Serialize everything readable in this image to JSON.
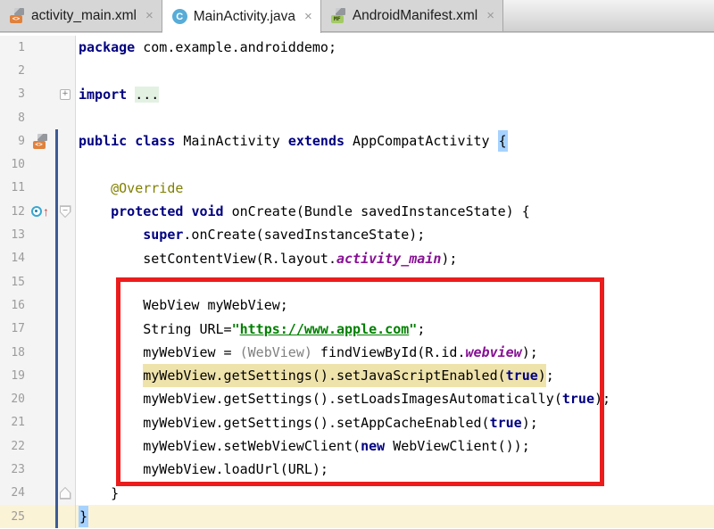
{
  "tabs": [
    {
      "id": "activity-main-xml",
      "label": "activity_main.xml",
      "icon": "layout-xml-icon",
      "glyph": "<>",
      "active": false
    },
    {
      "id": "mainactivity-java",
      "label": "MainActivity.java",
      "icon": "java-class-icon",
      "glyph": "C",
      "active": true
    },
    {
      "id": "androidmanifest-xml",
      "label": "AndroidManifest.xml",
      "icon": "manifest-xml-icon",
      "glyph": "MF",
      "active": false
    }
  ],
  "icons": {
    "close": "×",
    "fold_plus": "+",
    "fold_minus": "−",
    "override_arrow": "↑",
    "layout_badge": "<>",
    "manifest_badge": "MF",
    "java_class_letter": "C"
  },
  "colors": {
    "annotation_red": "#EC1C1C",
    "caret_row_highlight": "#FBF3D6",
    "statement_highlight": "#EFE3AC",
    "brace_match": "#A6D2FF",
    "keyword": "#000080",
    "string": "#008000",
    "resource_ref": "#871094",
    "annotation_text": "#808000",
    "vcs_modified_bar": "#3D5A96",
    "folded_code_bg": "#E3F1E3"
  },
  "annotation": {
    "shape": "rectangle",
    "color": "#EC1C1C"
  },
  "editor": {
    "lines": [
      {
        "num": "1",
        "indent": 0,
        "segments": [
          {
            "text": "package",
            "style": "kw"
          },
          {
            "text": " com.example.androiddemo;",
            "style": "plain"
          }
        ]
      },
      {
        "num": "2",
        "indent": 0,
        "segments": []
      },
      {
        "num": "3",
        "indent": 0,
        "fold": "plus",
        "segments": [
          {
            "text": "import",
            "style": "kw"
          },
          {
            "text": " ",
            "style": "plain"
          },
          {
            "text": "...",
            "style": "fold"
          }
        ]
      },
      {
        "num": "8",
        "indent": 0,
        "segments": []
      },
      {
        "num": "9",
        "indent": 0,
        "gutter_icon": "layout",
        "segments": [
          {
            "text": "public",
            "style": "kw"
          },
          {
            "text": " ",
            "style": "plain"
          },
          {
            "text": "class",
            "style": "kw"
          },
          {
            "text": " MainActivity ",
            "style": "plain"
          },
          {
            "text": "extends",
            "style": "kw"
          },
          {
            "text": " AppCompatActivity ",
            "style": "plain"
          },
          {
            "text": "{",
            "style": "brace"
          }
        ]
      },
      {
        "num": "10",
        "indent": 0,
        "segments": []
      },
      {
        "num": "11",
        "indent": 4,
        "segments": [
          {
            "text": "@Override",
            "style": "ann"
          }
        ]
      },
      {
        "num": "12",
        "indent": 4,
        "gutter_icon": "override",
        "fold": "open",
        "segments": [
          {
            "text": "protected",
            "style": "kw"
          },
          {
            "text": " ",
            "style": "plain"
          },
          {
            "text": "void",
            "style": "kw"
          },
          {
            "text": " onCreate(Bundle savedInstanceState) {",
            "style": "plain"
          }
        ]
      },
      {
        "num": "13",
        "indent": 8,
        "segments": [
          {
            "text": "super",
            "style": "kw"
          },
          {
            "text": ".onCreate(savedInstanceState);",
            "style": "plain"
          }
        ]
      },
      {
        "num": "14",
        "indent": 8,
        "segments": [
          {
            "text": "setContentView(R.layout.",
            "style": "plain"
          },
          {
            "text": "activity_main",
            "style": "res"
          },
          {
            "text": ");",
            "style": "plain"
          }
        ]
      },
      {
        "num": "15",
        "indent": 0,
        "segments": []
      },
      {
        "num": "16",
        "indent": 8,
        "segments": [
          {
            "text": "WebView myWebView;",
            "style": "plain"
          }
        ]
      },
      {
        "num": "17",
        "indent": 8,
        "segments": [
          {
            "text": "String URL=",
            "style": "plain"
          },
          {
            "text": "\"",
            "style": "str"
          },
          {
            "text": "https://www.apple.com",
            "style": "link"
          },
          {
            "text": "\"",
            "style": "str"
          },
          {
            "text": ";",
            "style": "plain"
          }
        ]
      },
      {
        "num": "18",
        "indent": 8,
        "segments": [
          {
            "text": "myWebView = ",
            "style": "plain"
          },
          {
            "text": "(WebView)",
            "style": "cast"
          },
          {
            "text": " findViewById(R.id.",
            "style": "plain"
          },
          {
            "text": "webview",
            "style": "res"
          },
          {
            "text": ");",
            "style": "plain"
          }
        ]
      },
      {
        "num": "19",
        "indent": 8,
        "segments": [
          {
            "text": "myWebView.getSettings().setJavaScriptEnabled(",
            "style": "plain hl"
          },
          {
            "text": "true",
            "style": "kw hl"
          },
          {
            "text": ")",
            "style": "plain hl"
          },
          {
            "text": ";",
            "style": "plain"
          }
        ]
      },
      {
        "num": "20",
        "indent": 8,
        "segments": [
          {
            "text": "myWebView.getSettings().setLoadsImagesAutomatically(",
            "style": "plain"
          },
          {
            "text": "true",
            "style": "kw"
          },
          {
            "text": ");",
            "style": "plain"
          }
        ]
      },
      {
        "num": "21",
        "indent": 8,
        "segments": [
          {
            "text": "myWebView.getSettings().setAppCacheEnabled(",
            "style": "plain"
          },
          {
            "text": "true",
            "style": "kw"
          },
          {
            "text": ");",
            "style": "plain"
          }
        ]
      },
      {
        "num": "22",
        "indent": 8,
        "segments": [
          {
            "text": "myWebView.setWebViewClient(",
            "style": "plain"
          },
          {
            "text": "new",
            "style": "kw"
          },
          {
            "text": " WebViewClient());",
            "style": "plain"
          }
        ]
      },
      {
        "num": "23",
        "indent": 8,
        "segments": [
          {
            "text": "myWebView.loadUrl(URL);",
            "style": "plain"
          }
        ]
      },
      {
        "num": "24",
        "indent": 4,
        "fold": "close",
        "segments": [
          {
            "text": "}",
            "style": "plain"
          }
        ]
      },
      {
        "num": "25",
        "indent": 0,
        "current": true,
        "segments": [
          {
            "text": "}",
            "style": "brace"
          }
        ]
      }
    ]
  }
}
